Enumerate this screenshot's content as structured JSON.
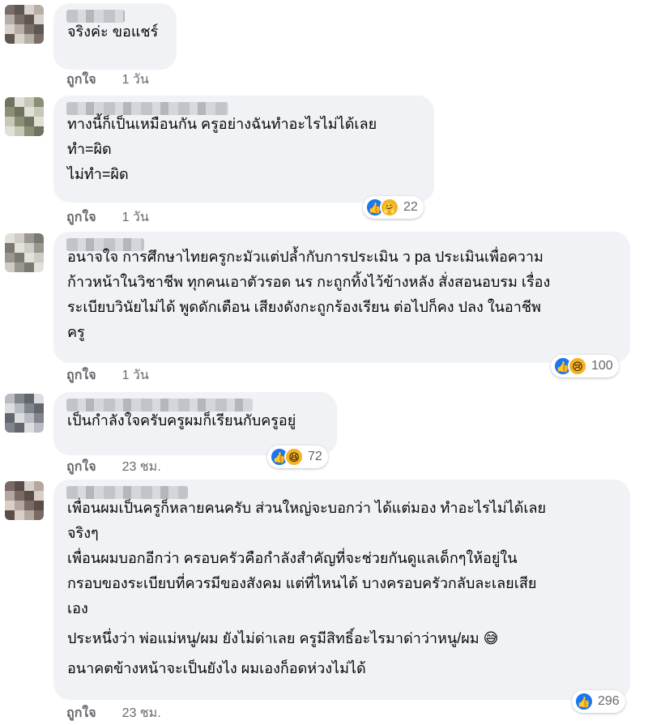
{
  "comments": [
    {
      "author": "",
      "lines": [
        "จริงค่ะ ขอแชร์"
      ],
      "like_label": "ถูกใจ",
      "time": "1 วัน",
      "reactions": null
    },
    {
      "author": "",
      "lines": [
        "ทางนี้ก็เป็นเหมือนกัน ครูอย่างฉันทำอะไรไม่ได้เลย",
        "ทำ=ผิด",
        "ไม่ทำ=ผิด"
      ],
      "like_label": "ถูกใจ",
      "time": "1 วัน",
      "reactions": {
        "icons": [
          "like-icon",
          "care-icon"
        ],
        "count": "22"
      }
    },
    {
      "author": "",
      "lines": [
        "อนาจใจ การศึกษาไทยครูกะมัวแต่ปล้ำกับการประเมิน ว pa ประเมินเพื่อความ",
        "ก้าวหน้าในวิชาชีพ ทุกคนเอาตัวรอด นร กะถูกทิ้งไว้ข้างหลัง สั่งสอนอบรม เรื่อง",
        "ระเบียบวินัยไม่ได้ พูดดักเตือน เสียงดังกะถูกร้องเรียน ต่อไปก็คง ปลง ในอาชีพ",
        "ครู"
      ],
      "like_label": "ถูกใจ",
      "time": "1 วัน",
      "reactions": {
        "icons": [
          "like-icon",
          "sad-icon"
        ],
        "count": "100"
      }
    },
    {
      "author": "",
      "lines": [
        "เป็นกำลังใจครับครูผมก็เรียนกับครูอยู่"
      ],
      "like_label": "ถูกใจ",
      "time": "23 ชม.",
      "reactions": {
        "icons": [
          "like-icon",
          "haha-icon"
        ],
        "count": "72"
      }
    },
    {
      "author": "",
      "lines": [
        "เพื่อนผมเป็นครูก็หลายคนครับ ส่วนใหญ่จะบอกว่า ได้แต่มอง ทำอะไรไม่ได้เลย",
        "จริงๆ",
        "เพื่อนผมบอกอีกว่า ครอบครัวคือกำลังสำคัญที่จะช่วยกันดูแลเด็กๆให้อยู่ใน",
        "กรอบของระเบียบที่ควรมีของสังคม แต่ที่ไหนได้ บางครอบครัวกลับละเลยเสีย",
        "เอง",
        "",
        "ประหนึ่งว่า พ่อแม่หนู/ผม ยังไม่ด่าเลย ครูมีสิทธิ์อะไรมาด่าว่าหนู/ผม 😅",
        "",
        "อนาคตข้างหน้าจะเป็นยังไง ผมเองก็อดห่วงไม่ได้"
      ],
      "like_label": "ถูกใจ",
      "time": "23 ชม.",
      "reactions": {
        "icons": [
          "like-icon"
        ],
        "count": "296"
      }
    }
  ],
  "reaction_glyphs": {
    "like-icon": "👍",
    "care-icon": "🤗",
    "sad-icon": "😢",
    "haha-icon": "😆"
  },
  "avatar_palettes": [
    [
      "#7a6f68",
      "#b7aea6",
      "#d8d2cc",
      "#5e564f"
    ],
    [
      "#8a8f76",
      "#c9c7b8",
      "#e1dfd6",
      "#6f7360"
    ],
    [
      "#9a9791",
      "#cfccc5",
      "#e4e1dc",
      "#7c7973"
    ],
    [
      "#80848c",
      "#b9bcc2",
      "#dcdde0",
      "#62666e"
    ],
    [
      "#7a6a63",
      "#b5a79f",
      "#d9cfc9",
      "#5b4e49"
    ]
  ]
}
